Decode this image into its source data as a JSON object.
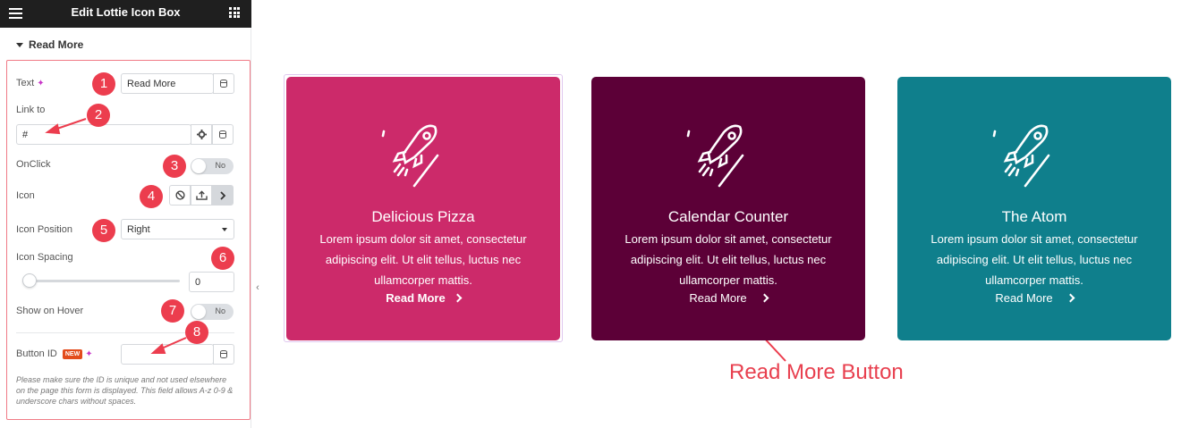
{
  "panel": {
    "title": "Edit Lottie Icon Box",
    "section": "Read More",
    "text_label": "Text",
    "text_value": "Read More",
    "link_label": "Link to",
    "link_value": "#",
    "onclick_label": "OnClick",
    "onclick_state": "No",
    "icon_label": "Icon",
    "icon_position_label": "Icon Position",
    "icon_position_value": "Right",
    "icon_spacing_label": "Icon Spacing",
    "icon_spacing_value": "0",
    "show_on_hover_label": "Show on Hover",
    "show_on_hover_state": "No",
    "button_id_label": "Button ID",
    "button_id_badge": "NEW",
    "button_id_value": "",
    "help_text": "Please make sure the ID is unique and not used elsewhere on the page this form is displayed. This field allows A-z 0-9 & underscore chars without spaces."
  },
  "markers": [
    "1",
    "2",
    "3",
    "4",
    "5",
    "6",
    "7",
    "8"
  ],
  "cards": [
    {
      "title": "Delicious Pizza",
      "body": "Lorem ipsum dolor sit amet, consectetur adipiscing elit. Ut elit tellus, luctus nec ullamcorper mattis.",
      "read_more": "Read More",
      "color": "#cc2a6a"
    },
    {
      "title": "Calendar Counter",
      "body": "Lorem ipsum dolor sit amet, consectetur adipiscing elit. Ut elit tellus, luctus nec ullamcorper mattis.",
      "read_more": "Read More",
      "color": "#5c0037"
    },
    {
      "title": "The Atom",
      "body": "Lorem ipsum dolor sit amet, consectetur adipiscing elit. Ut elit tellus, luctus nec ullamcorper mattis.",
      "read_more": "Read More",
      "color": "#0f7f8c"
    }
  ],
  "annotation": "Read More Button",
  "colors": {
    "accent_red": "#ec3d4e",
    "topbar": "#1f1f1f"
  },
  "icons": [
    "hamburger-icon",
    "grid-icon",
    "database-icon",
    "gear-icon",
    "ban-icon",
    "upload-icon",
    "chevron-right-icon",
    "rocket-icon",
    "sparkle-icon"
  ]
}
